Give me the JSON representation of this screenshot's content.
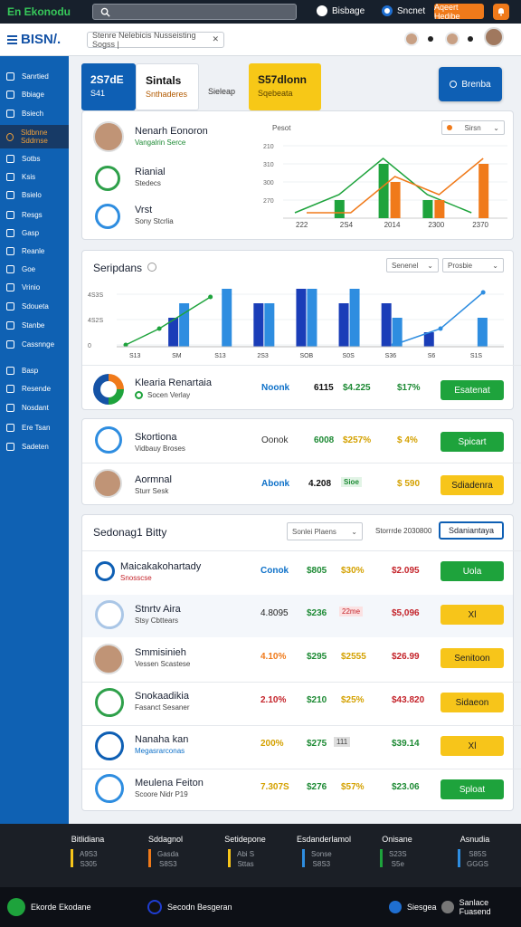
{
  "topbar": {
    "brand": "En Ekonodu",
    "nav1": "Bisbage",
    "nav2": "Sncnet",
    "button": "Aqeert Hedibe"
  },
  "header": {
    "logo": "BISN/.",
    "search_text": "Stenre Nelebicis Nusseisting Sogss |"
  },
  "sidebar": {
    "items": [
      "Sanrtied",
      "Bbiage",
      "Bsiech",
      "Sldbnne Sddrnse",
      "Sotbs",
      "Ksis",
      "Bsielo",
      "Resgs",
      "Gasp",
      "Reanle",
      "Goe",
      "Vrinio",
      "Sdoueta",
      "Stanbe",
      "Cassnnge",
      "Basp",
      "Resende",
      "Nosdant",
      "Ere Tsan",
      "Sadeten"
    ]
  },
  "kpis": [
    {
      "value": "2S7dE",
      "sub": "S41",
      "color": "#0e5fb4"
    },
    {
      "value": "Sintals",
      "sub": "Snthaderes",
      "color": "#ffffff"
    },
    {
      "value": "",
      "sub": "Sieleap",
      "color": "#eef1f5"
    },
    {
      "value": "S57dlonn",
      "sub": "Sqebeata",
      "color": "#f7c817"
    }
  ],
  "kpi_button": "Brenba",
  "overview": {
    "items": [
      {
        "title": "Nenarh Eonoron",
        "sub": "Vangalrin  Serce"
      },
      {
        "title": "Rianial",
        "sub": "Stedecs"
      },
      {
        "title": "Vrst",
        "sub": "Sony Stcrlia"
      }
    ],
    "chart_label": "Pesot",
    "select": "Sirsn"
  },
  "chart_data": [
    {
      "type": "bar",
      "title": "",
      "ylabel_ticks": [
        "210",
        "310",
        "300",
        "270"
      ],
      "categories": [
        "222",
        "2S4",
        "2014",
        "2300",
        "2370"
      ],
      "series": [
        {
          "color": "#1ea33c",
          "values": [
            0,
            1,
            3,
            1,
            0
          ]
        },
        {
          "color": "#f07a1a",
          "values": [
            0,
            0,
            2,
            1,
            3
          ]
        }
      ]
    },
    {
      "type": "bar",
      "title": "Seripdans",
      "yticks": [
        "4S3S",
        "4S2S",
        "0"
      ],
      "categories": [
        "S13",
        "SM",
        "S13",
        "2S3",
        "SOB",
        "S0S",
        "S36",
        "S6",
        "S1S"
      ],
      "series": [
        {
          "color": "#1a3db8",
          "values": [
            0,
            2,
            0,
            3,
            4,
            3,
            3,
            1,
            0
          ]
        },
        {
          "color": "#2e8de0",
          "values": [
            0,
            3,
            4,
            3,
            4,
            4,
            2,
            0,
            2
          ]
        }
      ]
    }
  ],
  "chart2": {
    "select1": "Senenel",
    "select2": "Prosbie"
  },
  "list1": [
    {
      "title": "Klearia Renartaia",
      "sub": "Socen Verlay",
      "label": "Noonk",
      "n1": "6115",
      "n2": "$4.225",
      "n3": "$17%",
      "button": "Esatenat"
    },
    {
      "title": "Skortiona",
      "sub": "Vidbauy Broses",
      "label": "Oonok",
      "n1": "6008",
      "n2": "$257%",
      "n3": "$ 4%",
      "button": "Spicart"
    },
    {
      "title": "Aormnal",
      "sub": "Sturr  Sesk",
      "label": "Abonk",
      "n1": "4.208",
      "n2": "Sioe",
      "n3": "$ 590",
      "button": "Sdiadenra"
    }
  ],
  "table": {
    "title": "Sedonag1 Bitty",
    "select": "Sonlei Plaens",
    "filter": "Storrrde 2030800",
    "button": "Sdaniantaya",
    "rows": [
      {
        "title": "Maicakakohartady",
        "sub": "Snosscse",
        "label": "Conok",
        "n1": "$805",
        "n2": "$30%",
        "n3": "$2.095",
        "button": "Uola"
      },
      {
        "title": "Stnrtv Aira",
        "sub": "Stsy Cbttears",
        "label": "4.8095",
        "n1": "$236",
        "n2": "22me",
        "n3": "$5,096",
        "button": "Xl"
      },
      {
        "title": "Smmisinieh",
        "sub": "Vessen Scastese",
        "label": "4.10%",
        "n1": "$295",
        "n2": "$2555",
        "n3": "$26.99",
        "button": "Senitoon"
      },
      {
        "title": "Snokaadikia",
        "sub": "Fasanct Sesaner",
        "label": "2.10%",
        "n1": "$210",
        "n2": "$25%",
        "n3": "$43.820",
        "button": "Sidaeon"
      },
      {
        "title": "Nanaha kan",
        "sub": "Megasrarconas",
        "label": "200%",
        "n1": "$275",
        "n2": "111",
        "n3": "$39.14",
        "button": "Xl"
      },
      {
        "title": "Meulena Feiton",
        "sub": "Scoore Nidr P19",
        "label": "7.307S",
        "n1": "$276",
        "n2": "$57%",
        "n3": "$23.06",
        "button": "Sploat"
      }
    ]
  },
  "footer": [
    {
      "title": "Bitlidiana",
      "l1": "A9S3",
      "l2": "S305",
      "color": "#f7c51a"
    },
    {
      "title": "Sddagnol",
      "l1": "Gasda",
      "l2": "S8S3",
      "color": "#f07a1a"
    },
    {
      "title": "Setidepone",
      "l1": "Abi S",
      "l2": "Sttas",
      "color": "#f7c51a"
    },
    {
      "title": "Esdanderlamol",
      "l1": "Sonse",
      "l2": "S8S3",
      "color": "#2e8de0"
    },
    {
      "title": "Onisane",
      "l1": "S23S",
      "l2": "S5e",
      "color": "#1ea33c"
    },
    {
      "title": "Asnudia",
      "l1": "S85S",
      "l2": "GGGS",
      "color": "#2e8de0"
    }
  ],
  "bottombar": {
    "brand": "Ekorde Ekodane",
    "item2": "Secodn Besgeran",
    "item3": "Siesgea",
    "item4": "Sanlace Fuasend"
  }
}
